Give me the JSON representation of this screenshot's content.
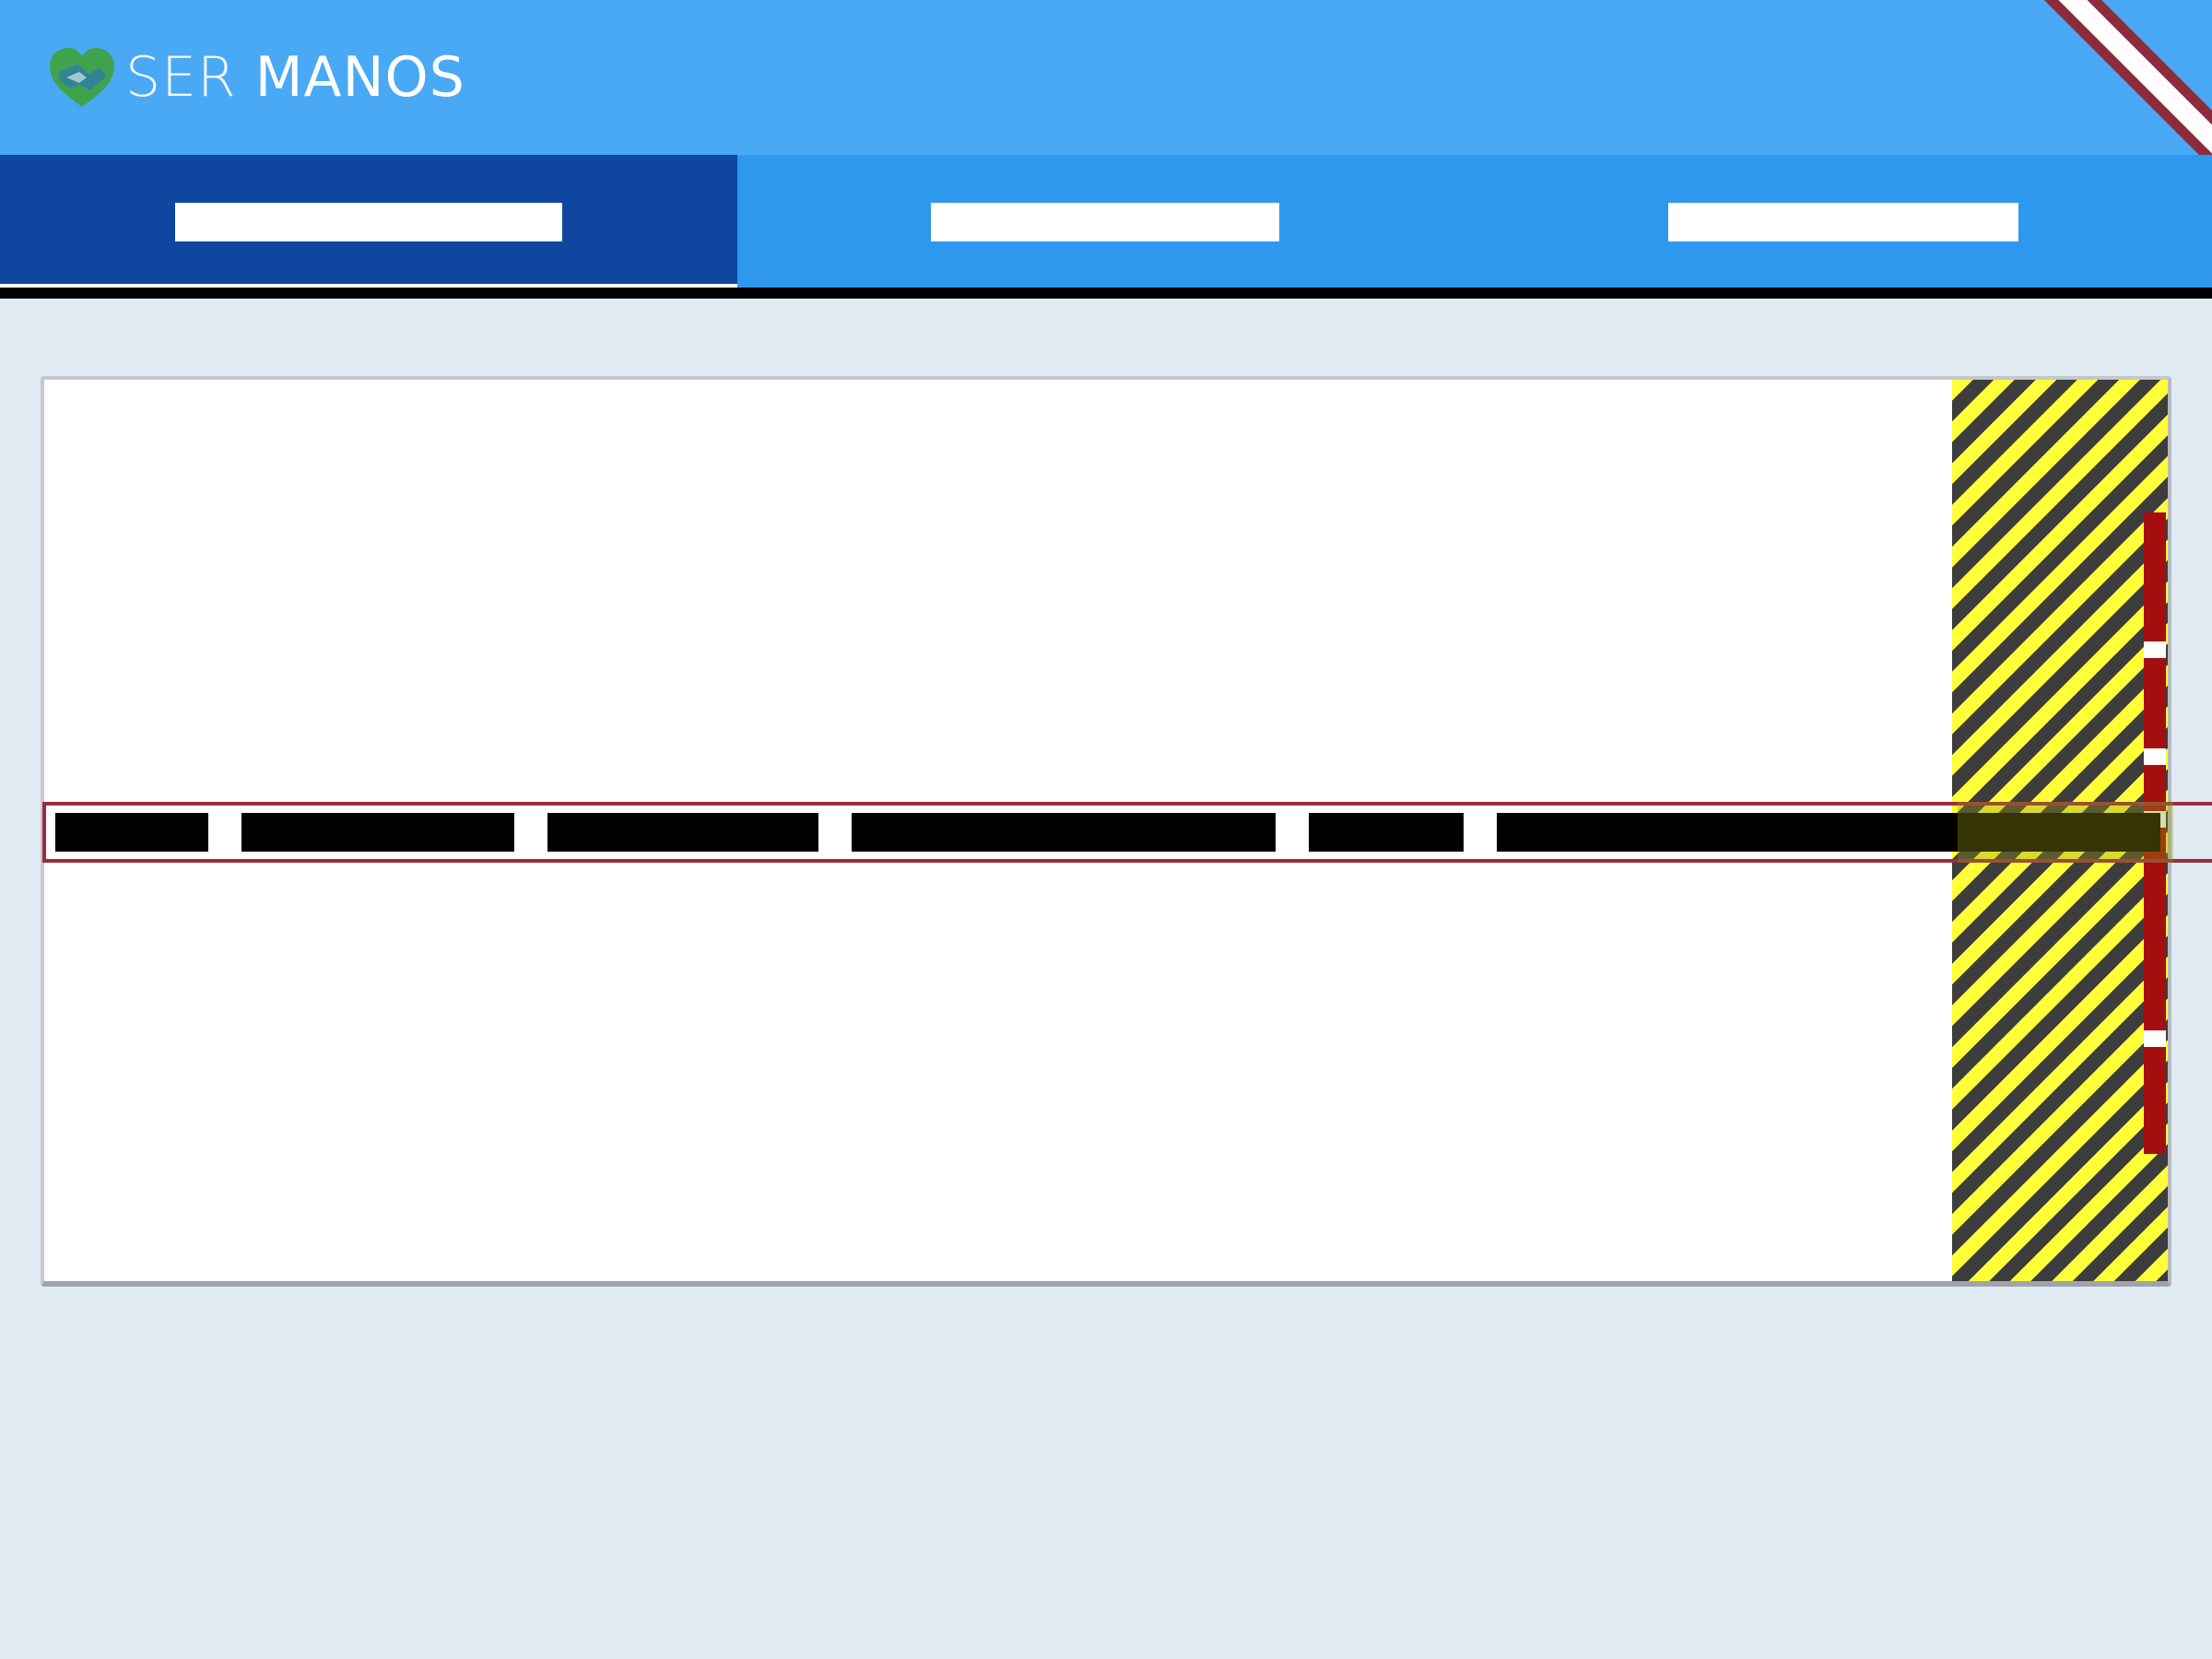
{
  "header": {
    "brand_light": "SER",
    "brand_bold": "MANOS",
    "logo_icon": "heart-hands-icon",
    "background_color": "#4aa9f4"
  },
  "tabs": [
    {
      "label": "",
      "active": true
    },
    {
      "label": "",
      "active": false
    },
    {
      "label": "",
      "active": false
    }
  ],
  "colors": {
    "tab_active": "#0e46a0",
    "tab_inactive": "#2e97ee",
    "hazard_yellow": "#ffff3a",
    "scroll_red": "#a50e0e",
    "row_border": "#9b2d3f"
  },
  "card": {
    "message_words": [
      "",
      "",
      "",
      "",
      "",
      ""
    ]
  }
}
